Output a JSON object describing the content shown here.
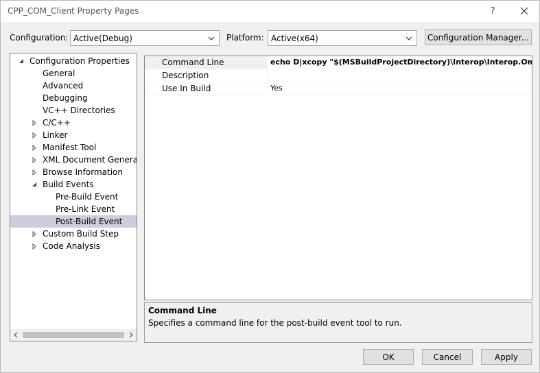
{
  "window": {
    "title": "CPP_COM_Client Property Pages",
    "help_glyph": "?",
    "close_icon": "close-icon"
  },
  "toolbar": {
    "configuration_label": "Configuration:",
    "configuration_value": "Active(Debug)",
    "platform_label": "Platform:",
    "platform_value": "Active(x64)",
    "config_manager_label": "Configuration Manager..."
  },
  "tree": {
    "items": [
      {
        "label": "Configuration Properties",
        "level": 0,
        "expander": "expanded"
      },
      {
        "label": "General",
        "level": 1,
        "expander": "none"
      },
      {
        "label": "Advanced",
        "level": 1,
        "expander": "none"
      },
      {
        "label": "Debugging",
        "level": 1,
        "expander": "none"
      },
      {
        "label": "VC++ Directories",
        "level": 1,
        "expander": "none"
      },
      {
        "label": "C/C++",
        "level": 1,
        "expander": "collapsed"
      },
      {
        "label": "Linker",
        "level": 1,
        "expander": "collapsed"
      },
      {
        "label": "Manifest Tool",
        "level": 1,
        "expander": "collapsed"
      },
      {
        "label": "XML Document Generator",
        "level": 1,
        "expander": "collapsed"
      },
      {
        "label": "Browse Information",
        "level": 1,
        "expander": "collapsed"
      },
      {
        "label": "Build Events",
        "level": 1,
        "expander": "expanded"
      },
      {
        "label": "Pre-Build Event",
        "level": 2,
        "expander": "none"
      },
      {
        "label": "Pre-Link Event",
        "level": 2,
        "expander": "none"
      },
      {
        "label": "Post-Build Event",
        "level": 2,
        "expander": "none",
        "selected": true
      },
      {
        "label": "Custom Build Step",
        "level": 1,
        "expander": "collapsed"
      },
      {
        "label": "Code Analysis",
        "level": 1,
        "expander": "collapsed"
      }
    ]
  },
  "properties": {
    "rows": [
      {
        "name": "Command Line",
        "value": "echo D|xcopy \"$(MSBuildProjectDirectory)\\Interop\\Interop.Omicron"
      },
      {
        "name": "Description",
        "value": ""
      },
      {
        "name": "Use In Build",
        "value": "Yes"
      }
    ]
  },
  "description": {
    "title": "Command Line",
    "text": "Specifies a command line for the post-build event tool to run."
  },
  "buttons": {
    "ok": "OK",
    "cancel": "Cancel",
    "apply": "Apply"
  },
  "colors": {
    "selection": "#cccedb",
    "border": "#828790",
    "button_face": "#e1e1e1"
  }
}
